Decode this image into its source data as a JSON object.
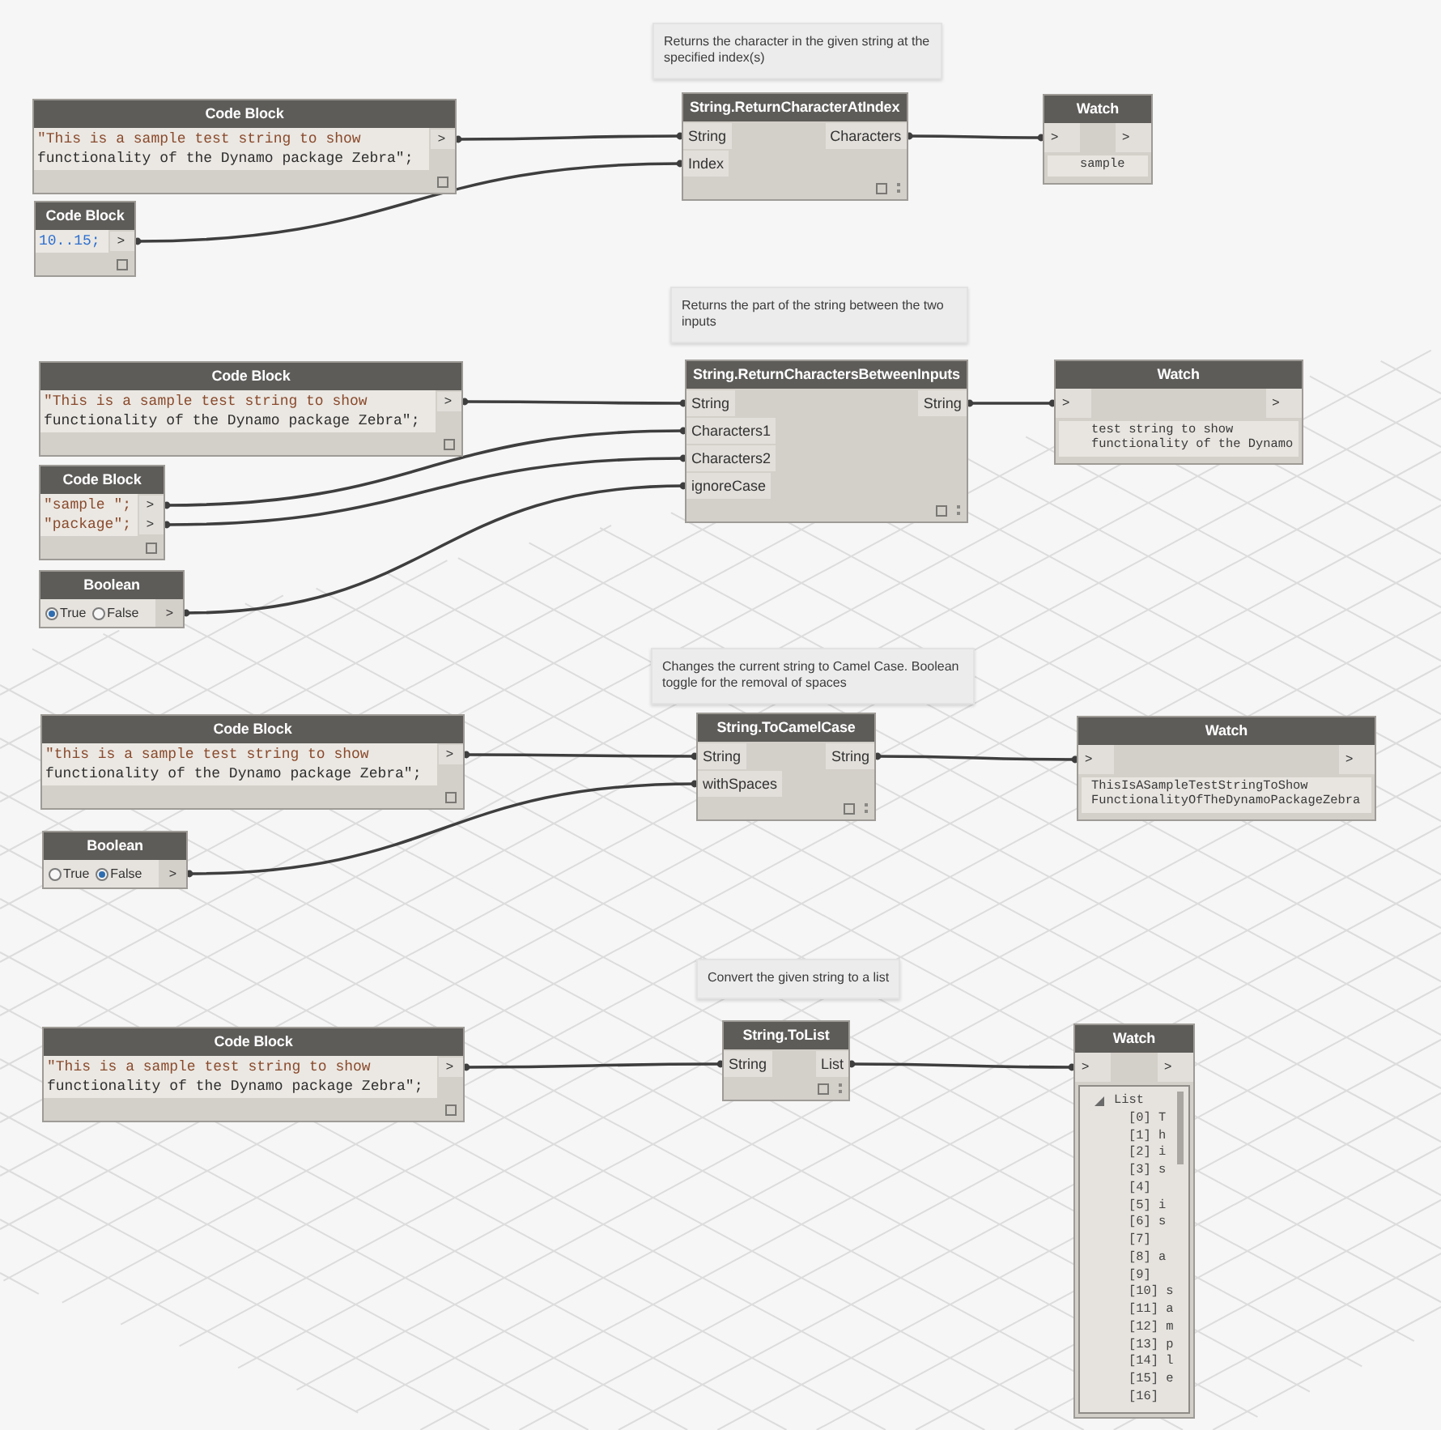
{
  "sections": [
    {
      "tooltip": "Returns the character in the given string at the specified index(s)",
      "sources": [
        {
          "kind": "code_block",
          "title": "Code Block",
          "statements": [
            {
              "lines": [
                {
                  "kind": "string",
                  "text": "\"This is a sample test string to show"
                },
                {
                  "kind": "plain",
                  "text": "functionality of the Dynamo package Zebra\";"
                }
              ],
              "port": ">"
            }
          ]
        },
        {
          "kind": "code_block",
          "title": "Code Block",
          "statements": [
            {
              "lines": [
                {
                  "kind": "number",
                  "text": "10..15;"
                }
              ],
              "port": ">"
            }
          ]
        }
      ],
      "function": {
        "title": "String.ReturnCharacterAtIndex",
        "inputs": [
          "String",
          "Index"
        ],
        "outputs": [
          "Characters"
        ]
      },
      "watch": {
        "kind": "text",
        "title": "Watch",
        "input": ">",
        "output": ">",
        "lines": [
          "sample"
        ]
      }
    },
    {
      "tooltip": "Returns the part of the string between the two inputs",
      "sources": [
        {
          "kind": "code_block",
          "title": "Code Block",
          "statements": [
            {
              "lines": [
                {
                  "kind": "string",
                  "text": "\"This is a sample test string to show"
                },
                {
                  "kind": "plain",
                  "text": "functionality of the Dynamo package Zebra\";"
                }
              ],
              "port": ">"
            }
          ]
        },
        {
          "kind": "code_block",
          "title": "Code Block",
          "statements": [
            {
              "lines": [
                {
                  "kind": "string",
                  "text": "\"sample \";"
                }
              ],
              "port": ">"
            },
            {
              "lines": [
                {
                  "kind": "string",
                  "text": "\"package\";"
                }
              ],
              "port": ">"
            }
          ]
        },
        {
          "kind": "boolean",
          "title": "Boolean",
          "options": [
            {
              "label": "True",
              "selected": true
            },
            {
              "label": "False",
              "selected": false
            }
          ],
          "port": ">"
        }
      ],
      "function": {
        "title": "String.ReturnCharactersBetweenInputs",
        "inputs": [
          "String",
          "Characters1",
          "Characters2",
          "ignoreCase"
        ],
        "outputs": [
          "String"
        ]
      },
      "watch": {
        "kind": "text",
        "title": "Watch",
        "input": ">",
        "output": ">",
        "lines": [
          "test string to show",
          "functionality of the Dynamo"
        ]
      }
    },
    {
      "tooltip": "Changes the current string to Camel Case. Boolean toggle for the removal of spaces",
      "sources": [
        {
          "kind": "code_block",
          "title": "Code Block",
          "statements": [
            {
              "lines": [
                {
                  "kind": "string",
                  "text": "\"this is a sample test string to show"
                },
                {
                  "kind": "plain",
                  "text": "functionality of the Dynamo package Zebra\";"
                }
              ],
              "port": ">"
            }
          ]
        },
        {
          "kind": "boolean",
          "title": "Boolean",
          "options": [
            {
              "label": "True",
              "selected": false
            },
            {
              "label": "False",
              "selected": true
            }
          ],
          "port": ">"
        }
      ],
      "function": {
        "title": "String.ToCamelCase",
        "inputs": [
          "String",
          "withSpaces"
        ],
        "outputs": [
          "String"
        ]
      },
      "watch": {
        "kind": "text",
        "title": "Watch",
        "input": ">",
        "output": ">",
        "lines": [
          "ThisIsASampleTestStringToShow",
          "FunctionalityOfTheDynamoPackageZebra"
        ]
      }
    },
    {
      "tooltip": "Convert the given string to a list",
      "sources": [
        {
          "kind": "code_block",
          "title": "Code Block",
          "statements": [
            {
              "lines": [
                {
                  "kind": "string",
                  "text": "\"This is a sample test string to show"
                },
                {
                  "kind": "plain",
                  "text": "functionality of the Dynamo package Zebra\";"
                }
              ],
              "port": ">"
            }
          ]
        }
      ],
      "function": {
        "title": "String.ToList",
        "inputs": [
          "String"
        ],
        "outputs": [
          "List"
        ]
      },
      "watch": {
        "kind": "list",
        "title": "Watch",
        "input": ">",
        "output": ">",
        "list": {
          "label": "List",
          "expanded": true,
          "items": [
            "[0] T",
            "[1] h",
            "[2] i",
            "[3] s",
            "[4]",
            "[5] i",
            "[6] s",
            "[7]",
            "[8] a",
            "[9]",
            "[10] s",
            "[11] a",
            "[12] m",
            "[13] p",
            "[14] l",
            "[15] e",
            "[16]"
          ]
        }
      }
    }
  ]
}
